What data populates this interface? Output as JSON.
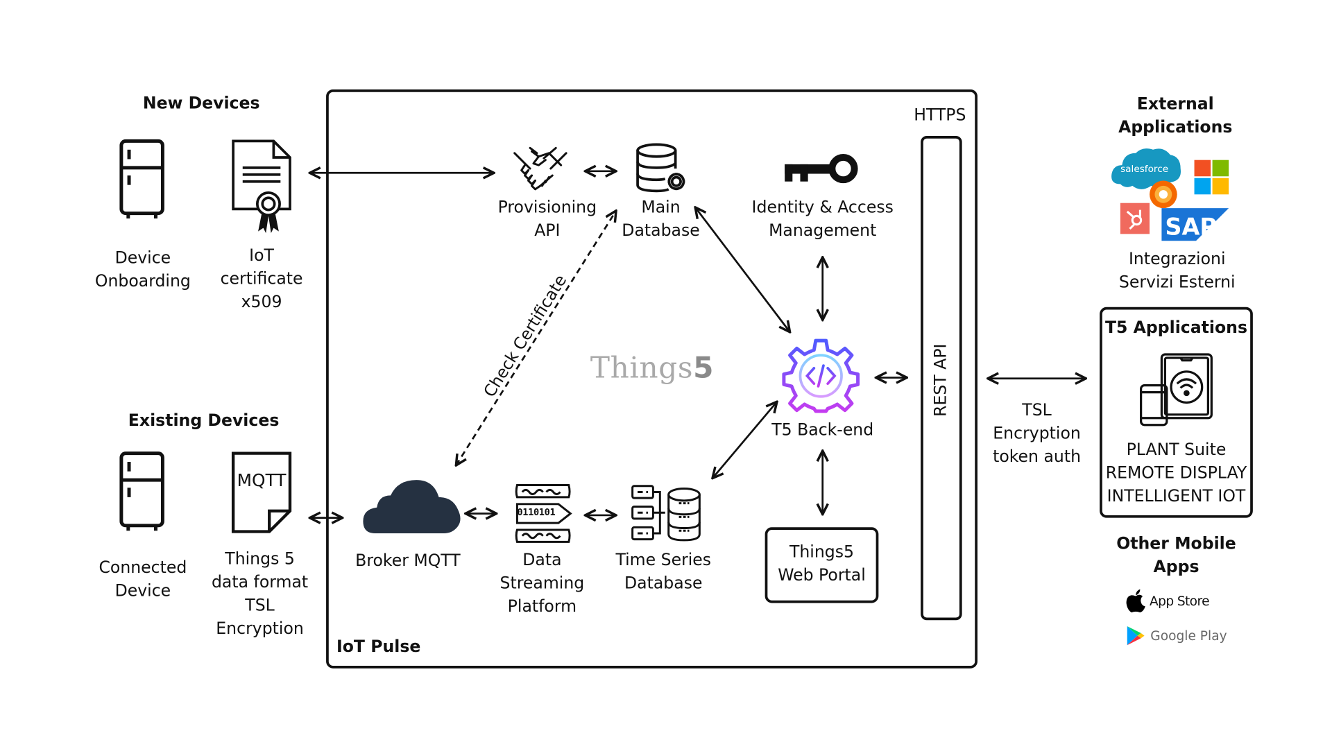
{
  "new_devices": {
    "title": "New Devices",
    "device_label": [
      "Device",
      "Onboarding"
    ],
    "cert_label": [
      "IoT",
      "certificate",
      "x509"
    ]
  },
  "existing_devices": {
    "title": "Existing Devices",
    "device_label": [
      "Connected",
      "Device"
    ],
    "doc_text": "MQTT",
    "doc_label": [
      "Things 5",
      "data format",
      "TSL",
      "Encryption"
    ]
  },
  "platform": {
    "name": "IoT Pulse",
    "https_label": "HTTPS",
    "rest_api_label": "REST API",
    "logo_text": "Things",
    "logo_number": "5",
    "provisioning": [
      "Provisioning",
      "API"
    ],
    "main_db": [
      "Main",
      "Database"
    ],
    "iam": [
      "Identity & Access",
      "Management"
    ],
    "check_certificate": "Check Certificate",
    "backend": "T5 Back-end",
    "broker": "Broker MQTT",
    "streaming": [
      "Data",
      "Streaming",
      "Platform"
    ],
    "stream_bits": "0110101",
    "timeseries": [
      "Time Series",
      "Database"
    ],
    "web_portal": [
      "Things5",
      "Web Portal"
    ]
  },
  "connection": {
    "label": [
      "TSL",
      "Encryption",
      "token auth"
    ]
  },
  "external": {
    "title": [
      "External",
      "Applications"
    ],
    "logos": [
      "salesforce",
      "microsoft",
      "grafana",
      "hubspot",
      "SAP"
    ],
    "label": [
      "Integrazioni",
      "Servizi Esterni"
    ]
  },
  "t5_apps": {
    "title": "T5 Applications",
    "items": [
      "PLANT Suite",
      "REMOTE DISPLAY",
      "INTELLIGENT IOT"
    ]
  },
  "mobile": {
    "title": [
      "Other Mobile",
      "Apps"
    ],
    "app_store": "App Store",
    "google_play": "Google Play"
  },
  "colors": {
    "ink": "#111111",
    "cloud": "#253141",
    "gear_top": "#4f5bff",
    "gear_bottom": "#c43cf0",
    "gear_inner": "#7fd3ff",
    "logo_gray": "#a9a9a9"
  }
}
